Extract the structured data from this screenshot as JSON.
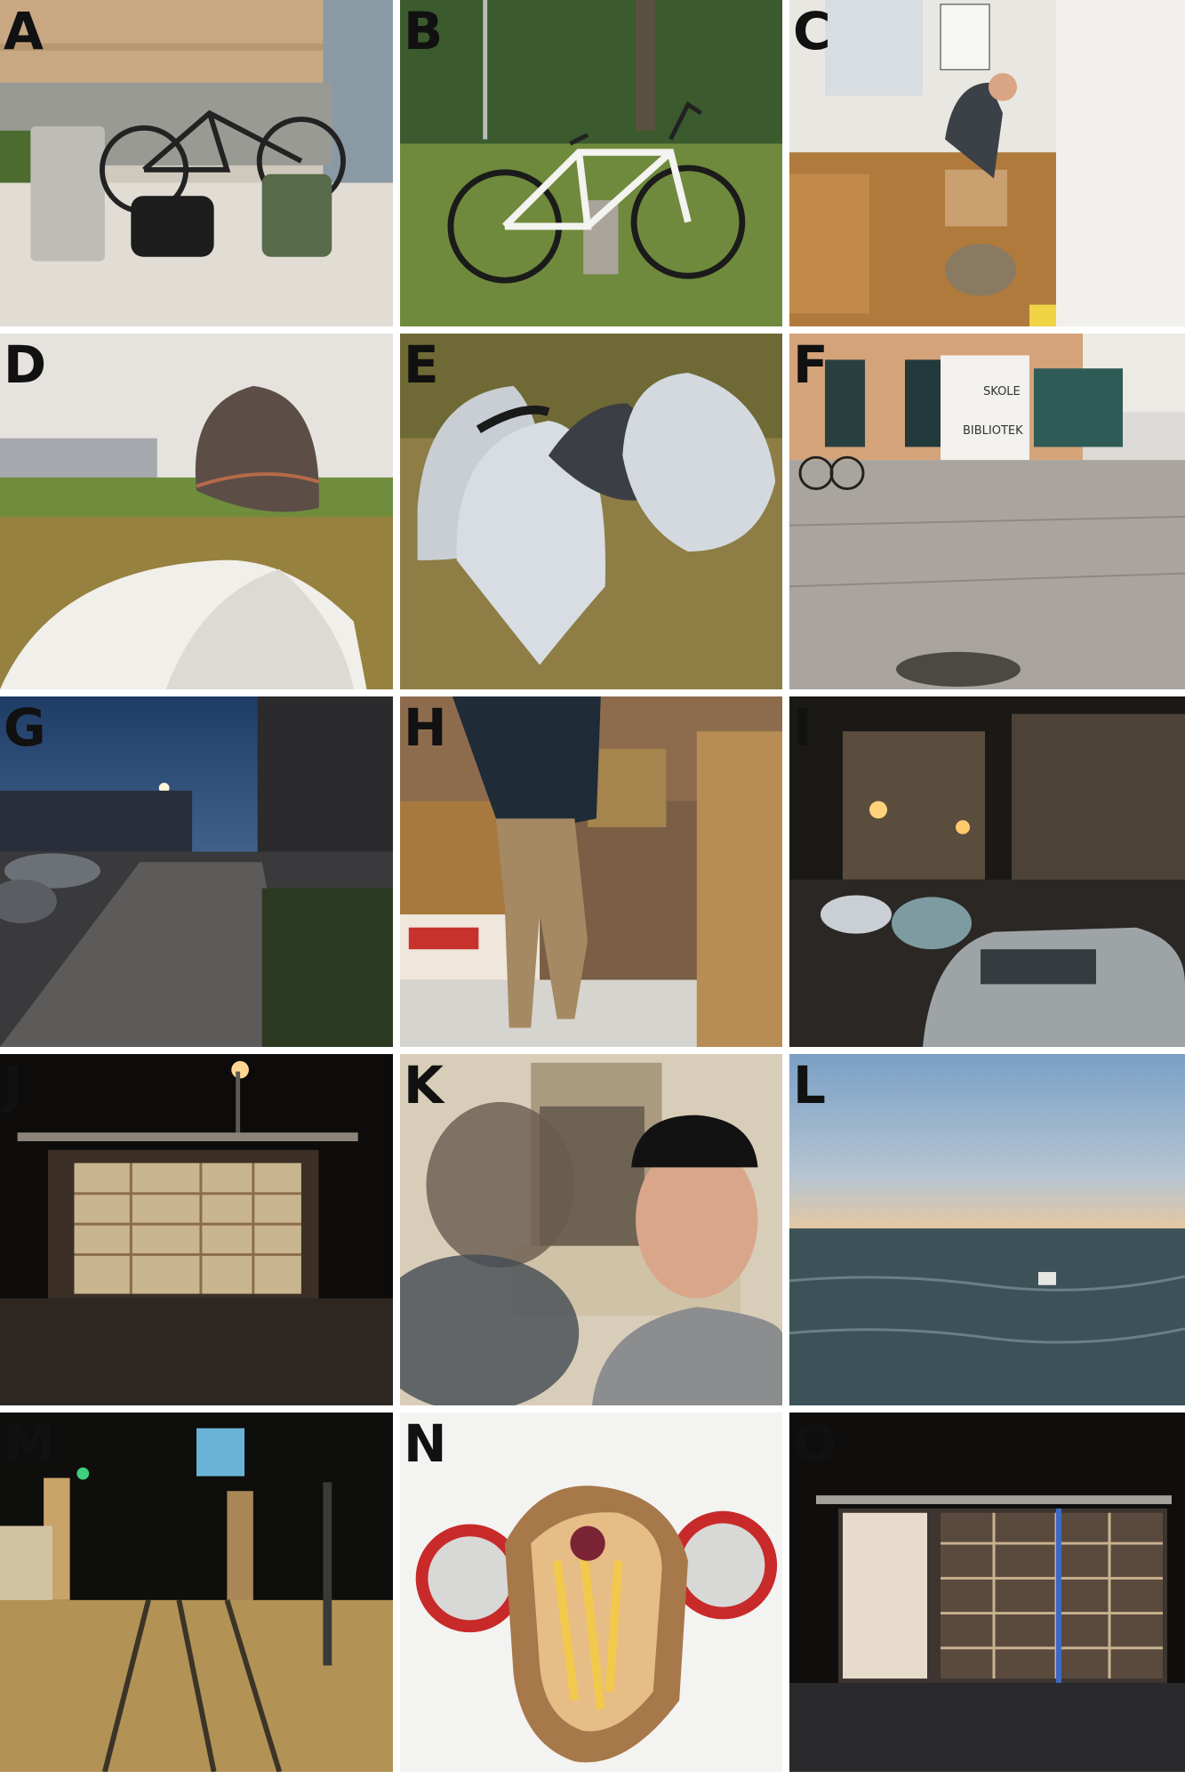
{
  "panels": [
    {
      "label": "A",
      "scene": "bicycle-with-bags"
    },
    {
      "label": "B",
      "scene": "road-bike-on-grass"
    },
    {
      "label": "C",
      "scene": "man-packing-room"
    },
    {
      "label": "D",
      "scene": "rock-and-bags"
    },
    {
      "label": "E",
      "scene": "bags-in-plastic"
    },
    {
      "label": "F",
      "scene": "school-library-building",
      "sign_top": "SKOLE",
      "sign_bottom": "BIBLIOTEK"
    },
    {
      "label": "G",
      "scene": "street-at-dusk"
    },
    {
      "label": "H",
      "scene": "bakery-shop"
    },
    {
      "label": "I",
      "scene": "night-street-cars"
    },
    {
      "label": "J",
      "scene": "book-shelter-night"
    },
    {
      "label": "K",
      "scene": "selfie-two-people"
    },
    {
      "label": "L",
      "scene": "sea-at-sunset"
    },
    {
      "label": "M",
      "scene": "railway-tracks-night"
    },
    {
      "label": "N",
      "scene": "falafel-and-cans"
    },
    {
      "label": "O",
      "scene": "book-shelter-lit"
    }
  ]
}
